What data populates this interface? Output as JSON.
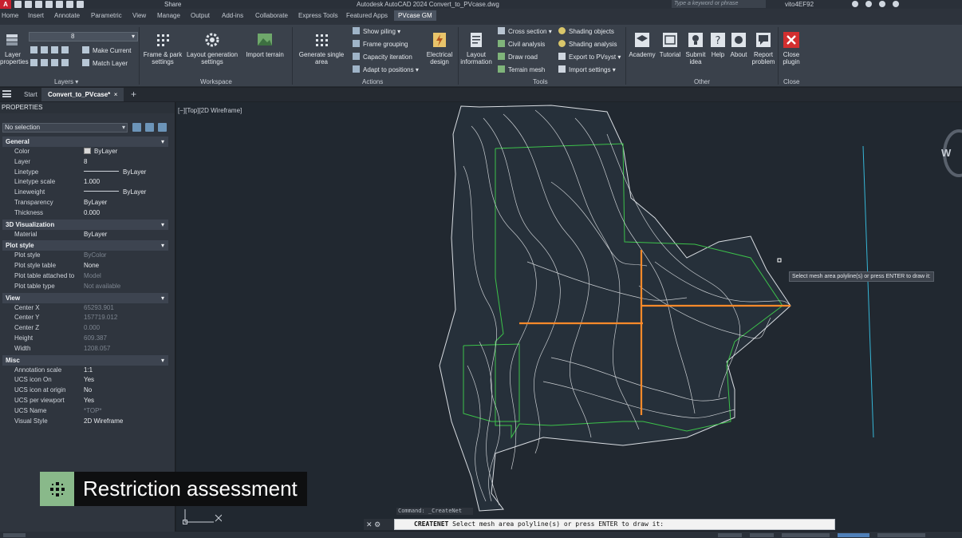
{
  "titlebar": {
    "app_logo": "A",
    "share": "Share",
    "title": "Autodesk AutoCAD 2024    Convert_to_PVcase.dwg",
    "search_placeholder": "Type a keyword or phrase",
    "user": "vito4EF92"
  },
  "ribbon_tabs": [
    "Home",
    "Insert",
    "Annotate",
    "Parametric",
    "View",
    "Manage",
    "Output",
    "Add-ins",
    "Collaborate",
    "Express Tools",
    "Featured Apps",
    "PVcase GM"
  ],
  "ribbon": {
    "layer_properties": "Layer properties",
    "layer_value": "8",
    "make_current": "Make Current",
    "match_layer": "Match Layer",
    "layers_label": "Layers",
    "frame_park": "Frame & park settings",
    "layout_gen": "Layout generation settings",
    "import_terrain": "Import terrain",
    "workspace_label": "Workspace",
    "gen_single": "Generate single area",
    "show_piling": "Show piling",
    "frame_grouping": "Frame grouping",
    "capacity_iteration": "Capacity iteration",
    "adapt_positions": "Adapt to positions",
    "electrical_design": "Electrical design",
    "actions_label": "Actions",
    "layout_information": "Layout information",
    "cross_section": "Cross section",
    "civil_analysis": "Civil analysis",
    "draw_road": "Draw road",
    "terrain_mesh": "Terrain mesh",
    "shading_objects": "Shading objects",
    "shading_analysis": "Shading analysis",
    "export_pvsyst": "Export to PVsyst",
    "import_settings": "Import settings",
    "tools_label": "Tools",
    "academy": "Academy",
    "tutorial": "Tutorial",
    "submit_idea": "Submit idea",
    "help": "Help",
    "about": "About",
    "report_problem": "Report problem",
    "other_label": "Other",
    "close_plugin": "Close plugin",
    "close_label": "Close"
  },
  "doctabs": {
    "start": "Start",
    "active": "Convert_to_PVcase*",
    "close": "×",
    "add": "+"
  },
  "properties": {
    "header": "PROPERTIES",
    "selection": "No selection",
    "sections": [
      {
        "title": "General",
        "rows": [
          {
            "k": "Color",
            "v": "ByLayer",
            "kind": "swatch"
          },
          {
            "k": "Layer",
            "v": "8"
          },
          {
            "k": "Linetype",
            "v": "ByLayer",
            "kind": "dash"
          },
          {
            "k": "Linetype scale",
            "v": "1.000"
          },
          {
            "k": "Lineweight",
            "v": "ByLayer",
            "kind": "dash"
          },
          {
            "k": "Transparency",
            "v": "ByLayer"
          },
          {
            "k": "Thickness",
            "v": "0.000"
          }
        ]
      },
      {
        "title": "3D Visualization",
        "rows": [
          {
            "k": "Material",
            "v": "ByLayer"
          }
        ]
      },
      {
        "title": "Plot style",
        "rows": [
          {
            "k": "Plot style",
            "v": "ByColor",
            "dim": true
          },
          {
            "k": "Plot style table",
            "v": "None"
          },
          {
            "k": "Plot table attached to",
            "v": "Model",
            "dim": true
          },
          {
            "k": "Plot table type",
            "v": "Not available",
            "dim": true
          }
        ]
      },
      {
        "title": "View",
        "rows": [
          {
            "k": "Center X",
            "v": "65293.901",
            "dim": true
          },
          {
            "k": "Center Y",
            "v": "157719.012",
            "dim": true
          },
          {
            "k": "Center Z",
            "v": "0.000",
            "dim": true
          },
          {
            "k": "Height",
            "v": "609.387",
            "dim": true
          },
          {
            "k": "Width",
            "v": "1208.057",
            "dim": true
          }
        ]
      },
      {
        "title": "Misc",
        "rows": [
          {
            "k": "Annotation scale",
            "v": "1:1"
          },
          {
            "k": "UCS icon On",
            "v": "Yes"
          },
          {
            "k": "UCS icon at origin",
            "v": "No"
          },
          {
            "k": "UCS per viewport",
            "v": "Yes"
          },
          {
            "k": "UCS Name",
            "v": "*TOP*",
            "dim": true
          },
          {
            "k": "Visual Style",
            "v": "2D Wireframe"
          }
        ]
      }
    ]
  },
  "canvas": {
    "viewport_label": "[−][Top][2D Wireframe]",
    "tooltip": "Select mesh area polyline(s) or press ENTER to draw it:",
    "viewcube_letter": "W"
  },
  "command": {
    "history": "Command: _CreateNet",
    "prompt_cmd": "CREATENET",
    "prompt_text": " Select mesh area polyline(s) or press ENTER to draw it:"
  },
  "caption": {
    "text": "Restriction assessment"
  },
  "colors": {
    "accent_tab": "#4b5461",
    "close_red": "#d32f2f",
    "orange_line": "#ff8a2a",
    "caption_badge": "#89b98a",
    "boundary_green": "#3cc24a"
  }
}
